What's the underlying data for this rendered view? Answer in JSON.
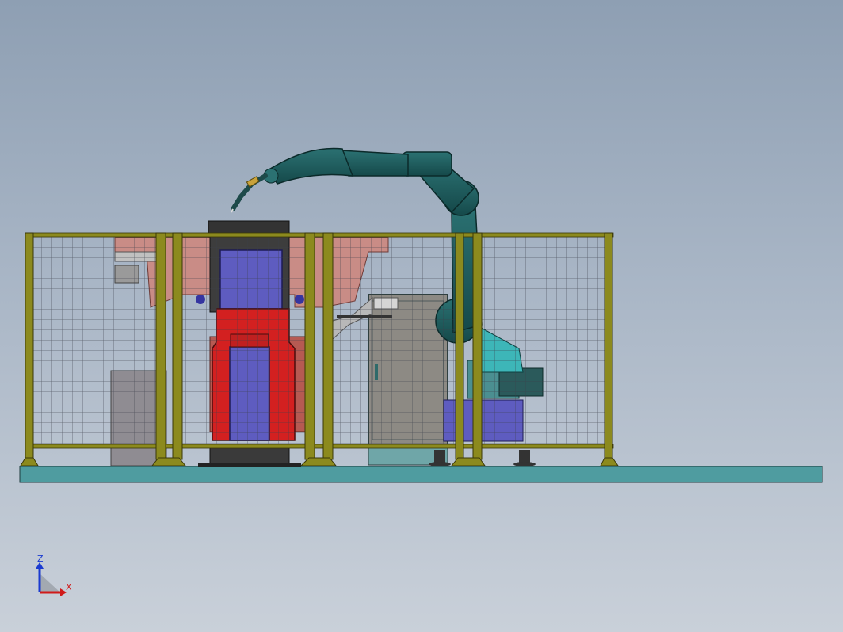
{
  "triad": {
    "z_label": "Z",
    "x_label": "X"
  },
  "colors": {
    "background_top": "#8e9fb3",
    "background_bottom": "#c9d0d9",
    "base_platform": "#4f9ca0",
    "fence_frame": "#8c8a1e",
    "fence_mesh": "#3c3f4a",
    "robot_body": "#1f5a5a",
    "positioner_red": "#d32020",
    "workpiece_blue": "#5e5cc0",
    "door_gray": "#8d8a84",
    "triad_z": "#1a3ad0",
    "triad_x": "#d01a1a"
  },
  "icons": [
    "axis-triad-icon"
  ]
}
